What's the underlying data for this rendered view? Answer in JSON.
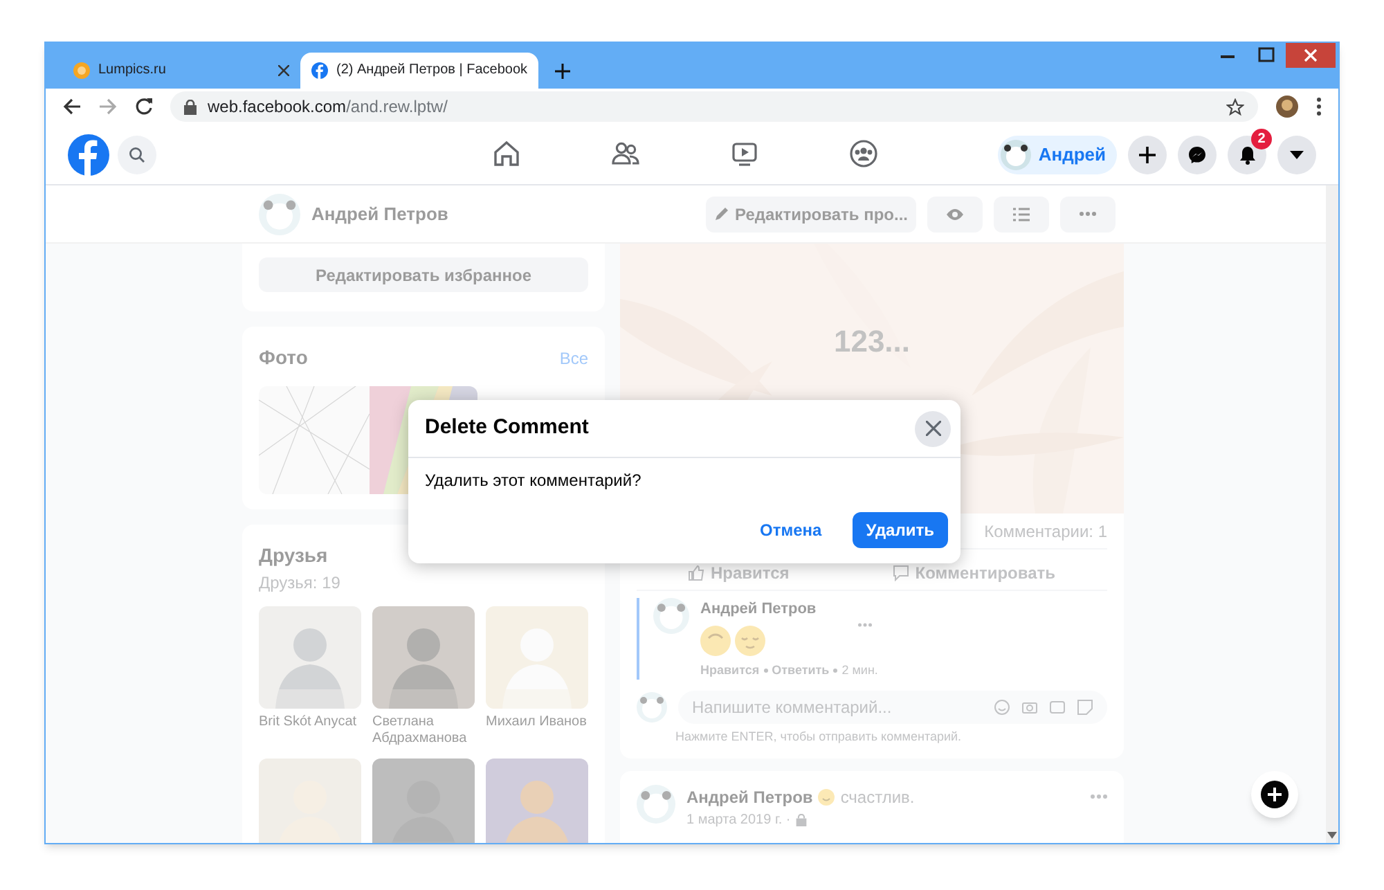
{
  "browser": {
    "tabs": [
      {
        "title": "Lumpics.ru",
        "selected": false
      },
      {
        "title": "(2) Андрей Петров | Facebook",
        "selected": true
      }
    ],
    "url_host": "web.facebook.com",
    "url_path": "/and.rew.lptw/"
  },
  "header": {
    "profile_chip": "Андрей",
    "notification_count": "2"
  },
  "profile_bar": {
    "name": "Андрей Петров",
    "edit_button": "Редактировать про..."
  },
  "favorites": {
    "edit_button": "Редактировать избранное"
  },
  "photos": {
    "title": "Фото",
    "see_all": "Все"
  },
  "friends": {
    "title": "Друзья",
    "count": "Друзья: 19",
    "people": [
      {
        "kind": "named",
        "name": "Brit Skót Anycat"
      },
      {
        "kind": "named",
        "name": "Светлана Абдрахманова"
      },
      {
        "kind": "named",
        "name": "Михаил Иванов"
      },
      {
        "kind": "picture"
      },
      {
        "kind": "picture"
      },
      {
        "kind": "picture"
      }
    ]
  },
  "post": {
    "cover_text": "123...",
    "comments_count": "Комментарии: 1",
    "actions": [
      "Нравится",
      "Комментировать"
    ],
    "comment": {
      "author": "Андрей Петров",
      "actions": [
        "Нравится",
        "Ответить"
      ],
      "time": "2 мин."
    },
    "comment_input": {
      "placeholder": "Напишите комментарий..."
    },
    "hint": "Нажмите ENTER, чтобы отправить комментарий."
  },
  "post_2": {
    "author": "Андрей Петров",
    "feeling": "счастлив.",
    "date": "1 марта 2019 г. ·"
  },
  "dialog": {
    "title": "Delete Comment",
    "message": "Удалить этот комментарий?",
    "cancel": "Отмена",
    "confirm": "Удалить"
  }
}
